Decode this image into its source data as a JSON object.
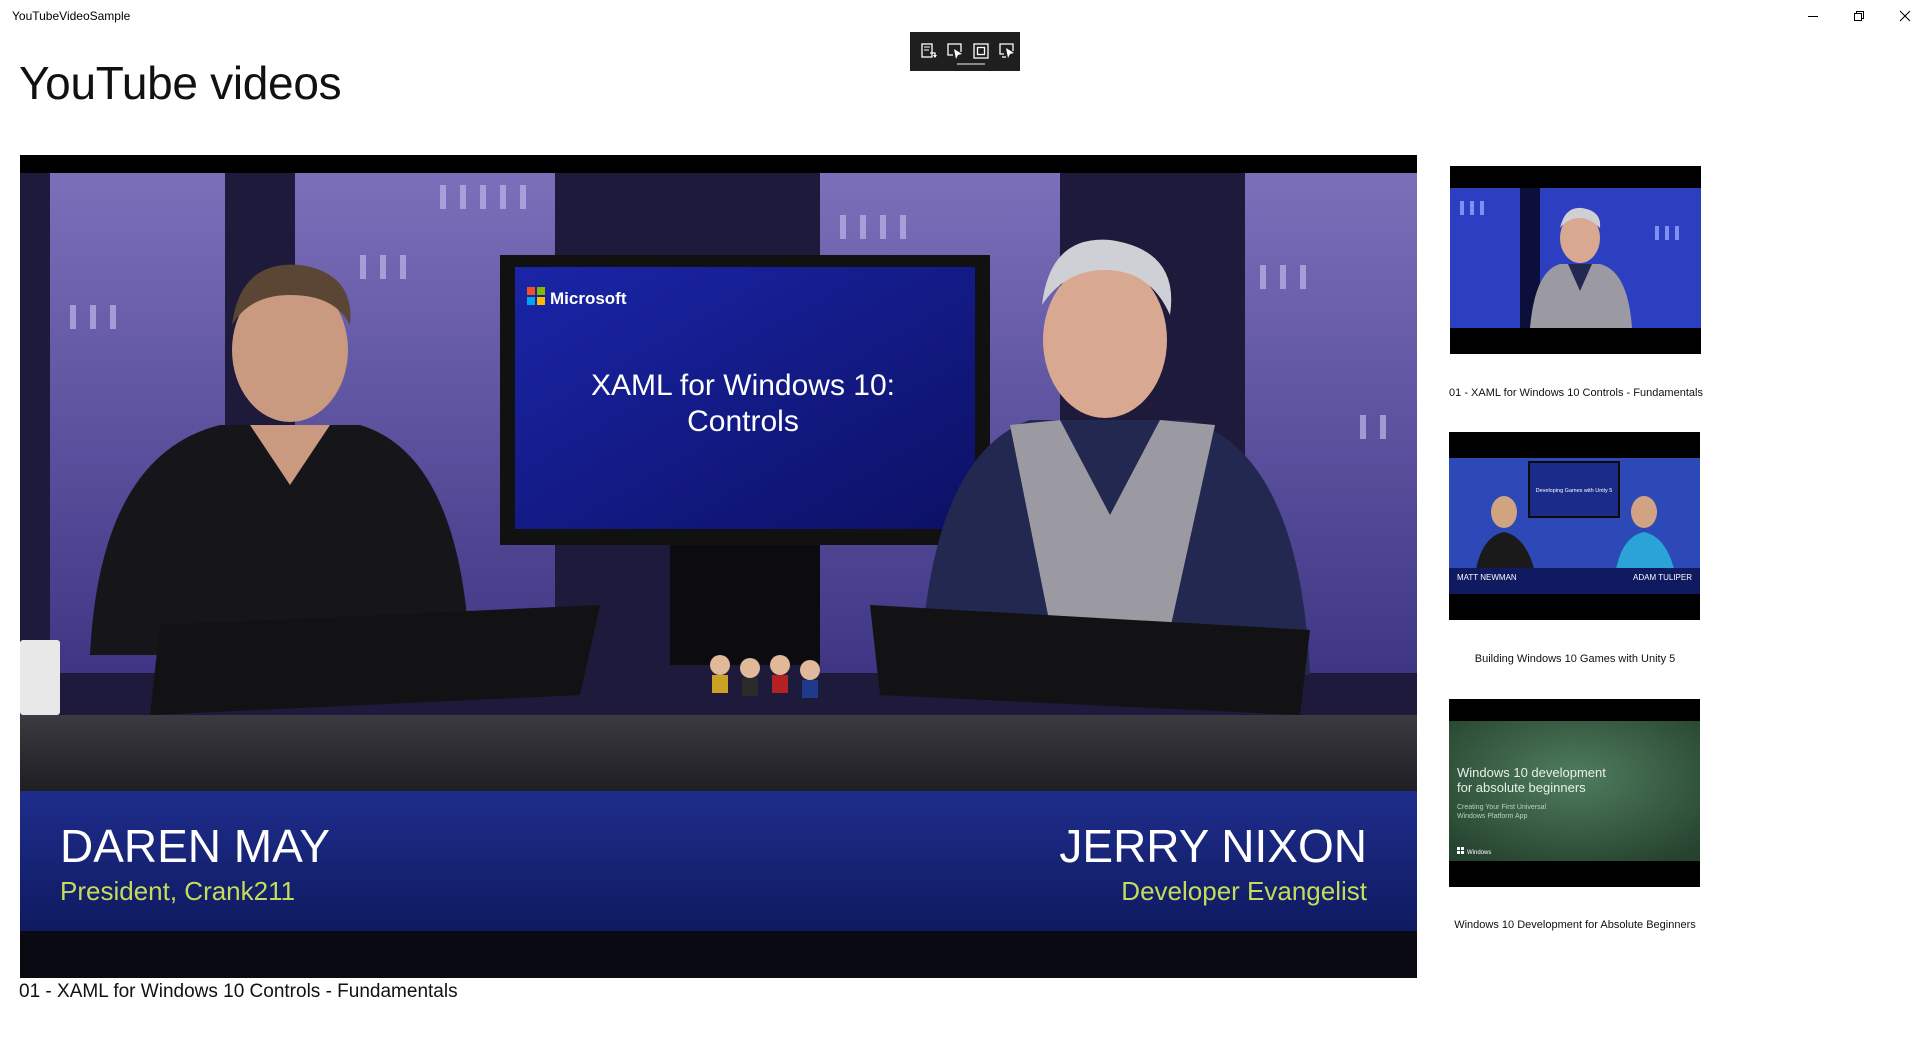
{
  "window": {
    "title": "YouTubeVideoSample"
  },
  "page": {
    "title": "YouTube videos"
  },
  "player": {
    "current_title": "01 - XAML for Windows 10 Controls - Fundamentals",
    "frame": {
      "monitor_brand": "Microsoft",
      "monitor_line1": "XAML for Windows 10:",
      "monitor_line2": "Controls",
      "left_name": "DAREN MAY",
      "left_role": "President, Crank211",
      "right_name": "JERRY NIXON",
      "right_role": "Developer Evangelist"
    }
  },
  "playlist": [
    {
      "title": "01 - XAML for Windows 10 Controls - Fundamentals"
    },
    {
      "title": "Building Windows 10 Games with Unity 5",
      "thumb_text": {
        "screen": "Developing Games with Unity 5",
        "left_name": "MATT NEWMAN",
        "right_name": "ADAM TULIPER"
      }
    },
    {
      "title": "Windows 10 Development for Absolute Beginners",
      "thumb_text": {
        "line1": "Windows 10 development",
        "line2": "for absolute beginners",
        "sub1": "Creating Your First Universal",
        "sub2": "Windows Platform App",
        "brand": "Windows"
      }
    }
  ],
  "icons": {
    "debug_toolbar": [
      "live-visual-tree-icon",
      "select-element-icon",
      "display-layout-adorners-icon",
      "track-focus-icon"
    ],
    "window_controls": [
      "minimize-icon",
      "restore-icon",
      "close-icon"
    ]
  },
  "colors": {
    "background": "#ffffff",
    "debug_toolbar": "#1f1f1f",
    "studio_purple": "#6a5fae",
    "lower_third_blue": "#1c2c85",
    "name_green": "#c4dc5a"
  }
}
